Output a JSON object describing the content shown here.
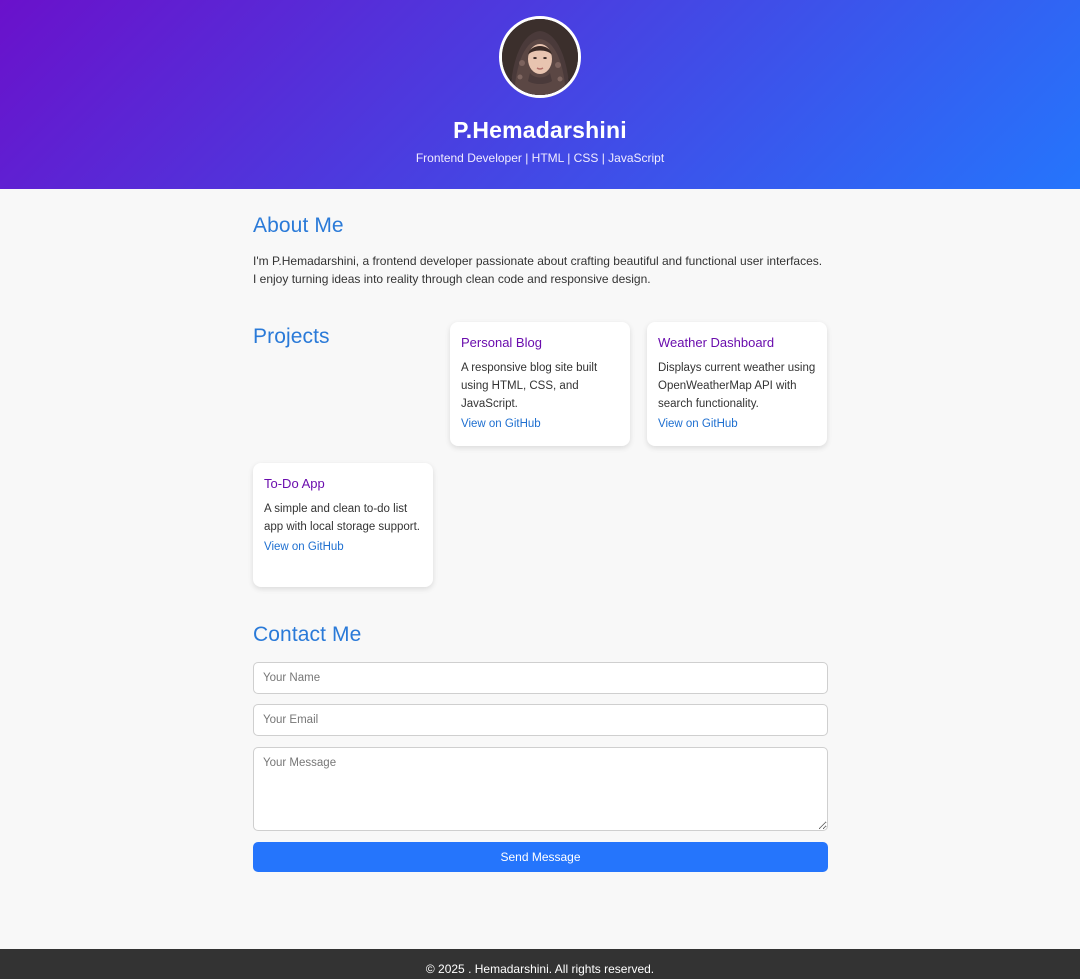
{
  "header": {
    "name": "P.Hemadarshini",
    "tagline": "Frontend Developer | HTML | CSS | JavaScript"
  },
  "about": {
    "title": "About Me",
    "text": "I'm P.Hemadarshini, a frontend developer passionate about crafting beautiful and functional user interfaces. I enjoy turning ideas into reality through clean code and responsive design."
  },
  "projects": {
    "title": "Projects",
    "items": [
      {
        "title": "Personal Blog",
        "description": "A responsive blog site built using HTML, CSS, and JavaScript.",
        "link_label": "View on GitHub"
      },
      {
        "title": "Weather Dashboard",
        "description": "Displays current weather using OpenWeatherMap API with search functionality.",
        "link_label": "View on GitHub"
      },
      {
        "title": "To-Do App",
        "description": "A simple and clean to-do list app with local storage support.",
        "link_label": "View on GitHub"
      }
    ]
  },
  "contact": {
    "title": "Contact Me",
    "name_placeholder": "Your Name",
    "email_placeholder": "Your Email",
    "message_placeholder": "Your Message",
    "submit_label": "Send Message"
  },
  "footer": {
    "text": "© 2025 . Hemadarshini. All rights reserved."
  },
  "colors": {
    "gradient_start": "#6a11cb",
    "gradient_end": "#2575fc",
    "heading_blue": "#2a7ad8",
    "card_title_purple": "#6a0dad",
    "button_blue": "#2575fc",
    "footer_bg": "#333333"
  }
}
